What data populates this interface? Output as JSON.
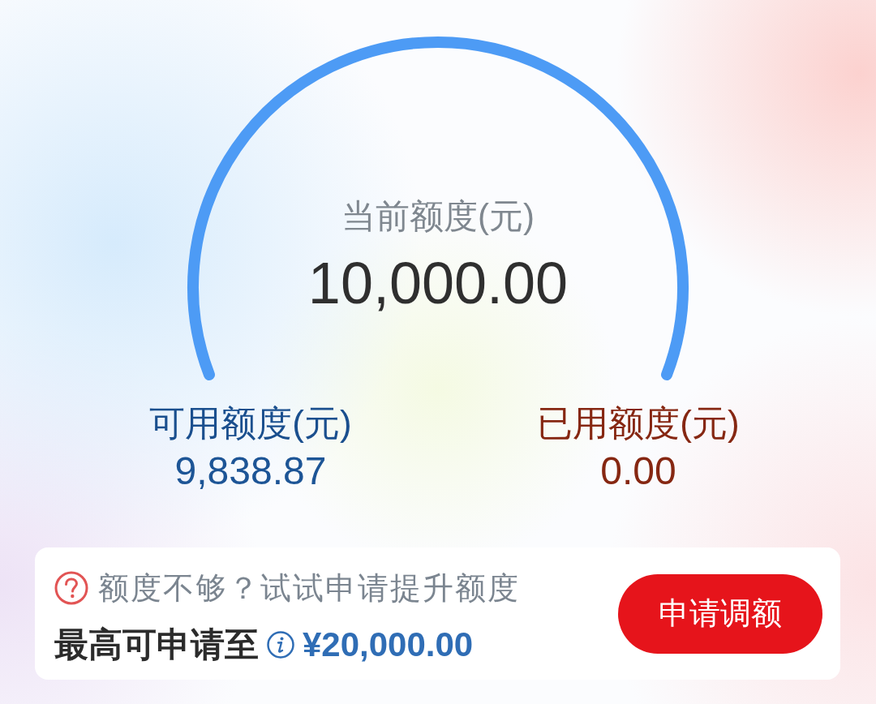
{
  "gauge": {
    "title": "当前额度(元)",
    "amount": "10,000.00"
  },
  "stats": [
    {
      "kind": "available",
      "label": "可用额度(元)",
      "value": "9,838.87"
    },
    {
      "kind": "used",
      "label": "已用额度(元)",
      "value": "0.00"
    }
  ],
  "promo": {
    "hint": "额度不够？试试申请提升额度",
    "max_label": "最高可申请至",
    "max_amount": "¥20,000.00",
    "button": "申请调额"
  }
}
